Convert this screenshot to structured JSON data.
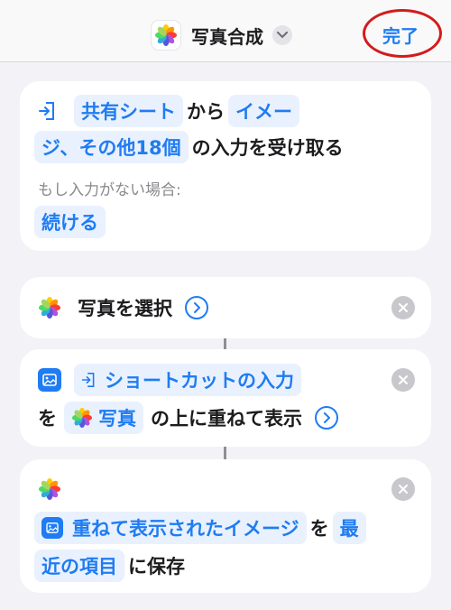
{
  "nav": {
    "title": "写真合成",
    "done": "完了"
  },
  "receive": {
    "share_sheet": "共有シート",
    "from": "から",
    "types_a": "イメー",
    "types_b": "ジ、その他18個",
    "suffix": "の入力を受け取る",
    "if_no_input": "もし入力がない場合:",
    "continue": "続ける"
  },
  "select_photos": {
    "label": "写真を選択"
  },
  "overlay": {
    "input_token": "ショートカットの入力",
    "wo": "を",
    "photo_token": "写真",
    "suffix": "の上に重ねて表示"
  },
  "save": {
    "image_token": "重ねて表示されたイメージ",
    "wo": "を",
    "album_a": "最",
    "album_b": "近の項目",
    "suffix": "に保存"
  },
  "colors": {
    "accent": "#1f7cf2",
    "annotation": "#d41b1b"
  }
}
